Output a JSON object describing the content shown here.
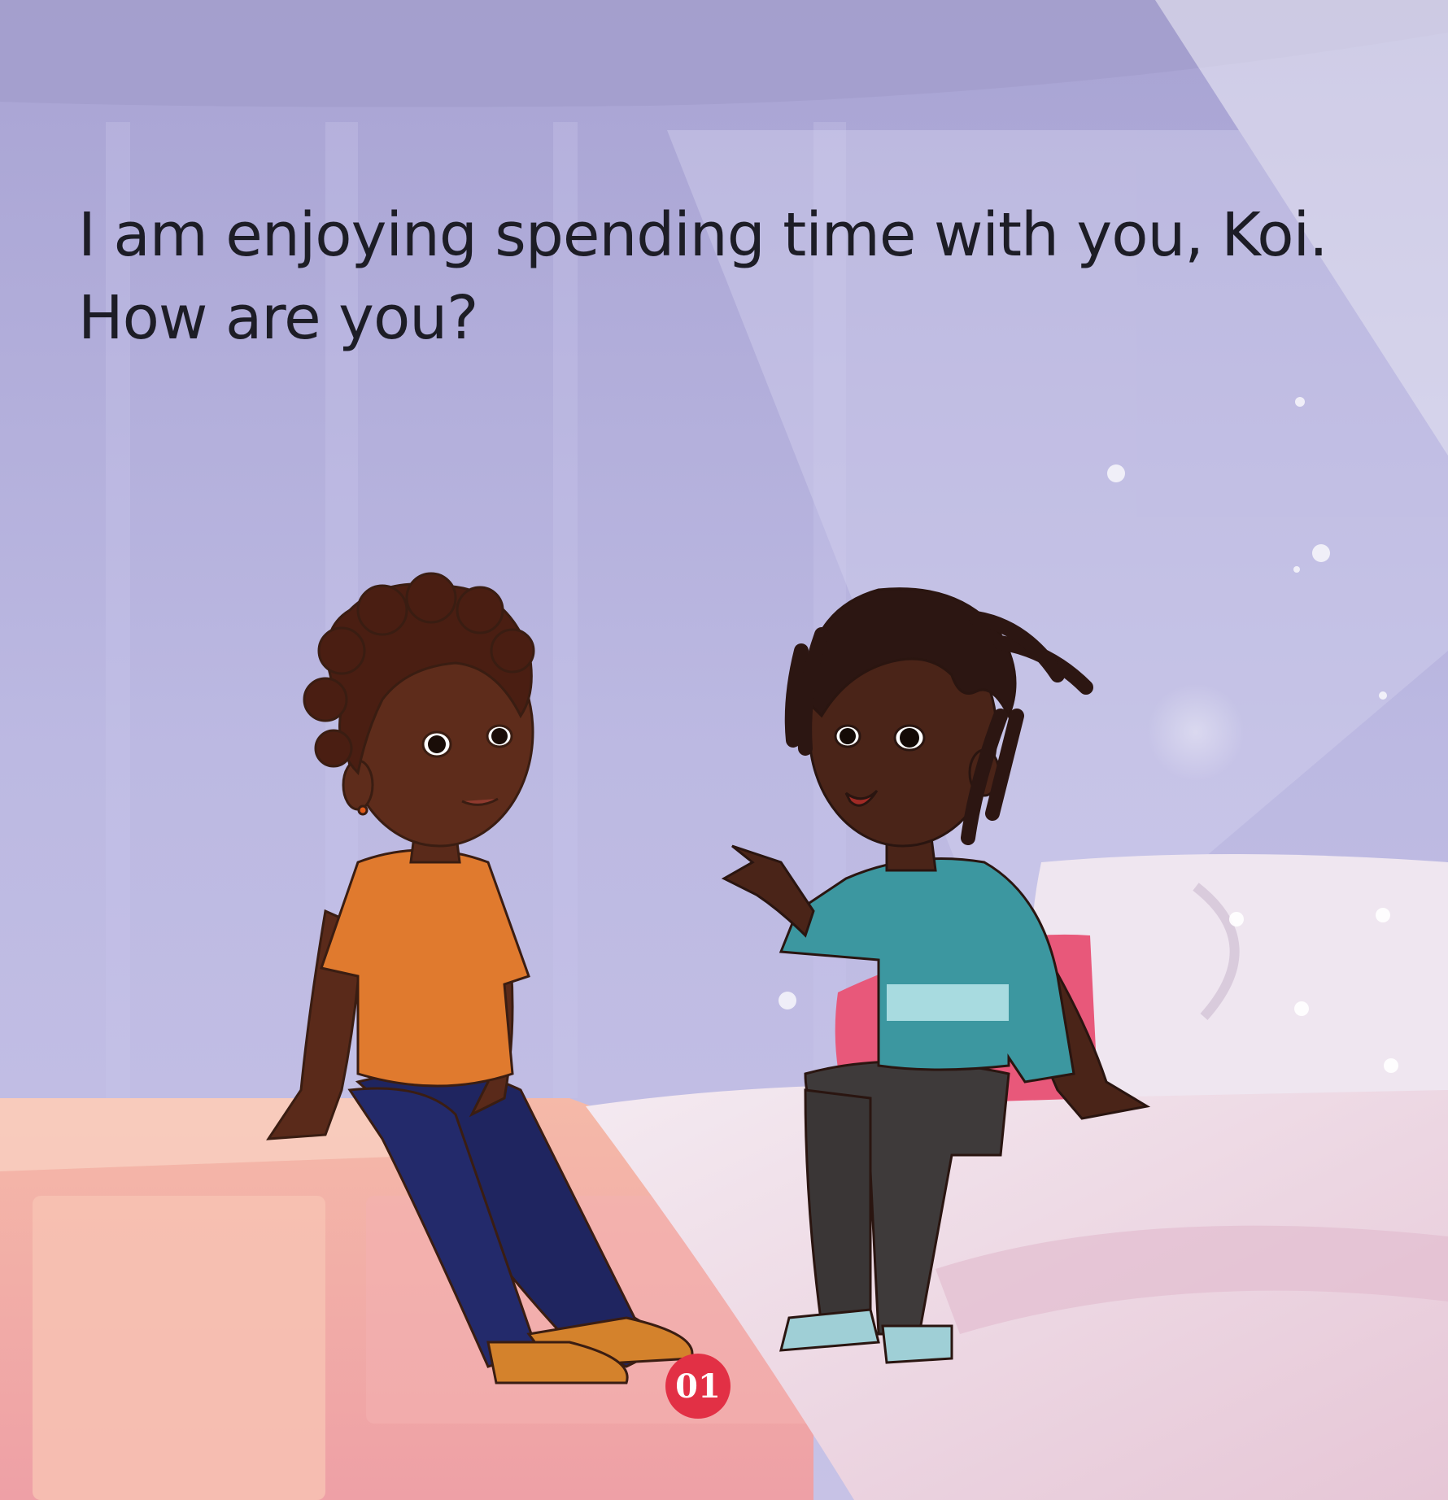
{
  "story": {
    "line1": "I am enjoying spending time with you, Koi.",
    "line2": "How are you?"
  },
  "page_number": "01",
  "illustration": {
    "colors": {
      "wall": "#b9b6de",
      "bed": "#f0a8a8",
      "pillow_pink": "#e8587a",
      "blanket": "#f1e4ea",
      "left_child_shirt": "#e07a2e",
      "left_child_pants": "#1f2560",
      "right_child_sweater": "#3c97a0",
      "right_child_pants": "#3e3a3a",
      "page_number_badge": "#e23045"
    }
  }
}
